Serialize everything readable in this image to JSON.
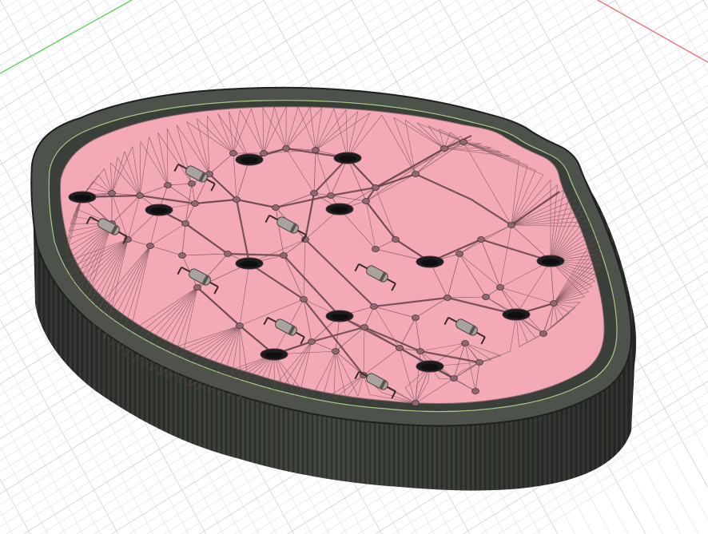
{
  "app": {
    "view": "3d-model-viewport",
    "grid": true
  },
  "colors": {
    "background": "#ffffff",
    "grid_minor": "#e7e9ec",
    "grid_major": "#d3d6da",
    "axis_x": "#ef7272",
    "axis_y": "#5bd05b",
    "body_dark": "#2f332f",
    "body_mid": "#4b4f49",
    "rim_top": "#6b6f68",
    "rim_edge": "#9bc07a",
    "face_fill": "#f3a9b6",
    "mesh_lines": "#6a4850",
    "hole": "#1e1e1e",
    "component": "#9a9591"
  },
  "model": {
    "shape": "keyboard-case-tray",
    "mesh": "triangulated-surface",
    "holes_count": 12,
    "components_count": 8
  }
}
